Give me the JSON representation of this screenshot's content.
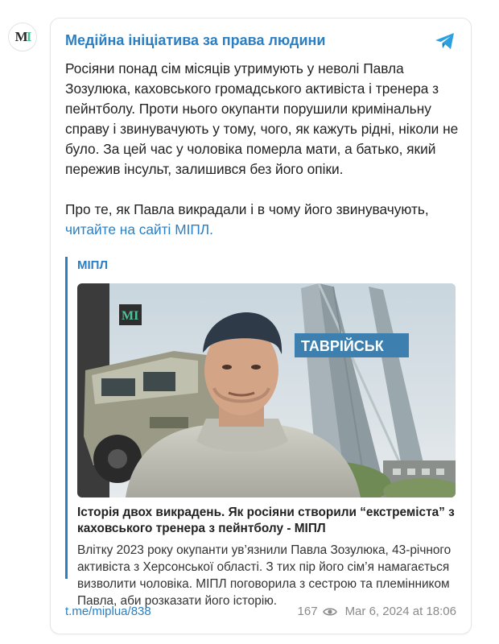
{
  "channel": {
    "name": "Медійна ініціатива за права людини",
    "avatar_mark": "МІ",
    "avatar_accent": "#4fc19a"
  },
  "post": {
    "paragraph1": "Росіяни понад сім місяців утримують у неволі Павла Зозулюка, каховського громадського активіста і тренера з пейнтболу. Проти нього окупанти порушили кримінальну справу і звинувачують у тому, чого, як кажуть рідні, ніколи не було. За цей час у чоловіка померла мати, а батько, який пережив інсульт, залишився без його опіки.",
    "paragraph2_text": "Про те, як Павла викрадали і в чому його звинувачують, ",
    "paragraph2_link": "читайте на сайті МІПЛ."
  },
  "preview": {
    "site": "МІПЛ",
    "image_sign_text": "ТАВРІЙСЬК",
    "image_logo": "МІ",
    "title": "Історія двох викрадень. Як росіяни створили “екстреміста” з каховського тренера з пейнтболу - МІПЛ",
    "description": "Влітку 2023 року окупанти ув’язнили Павла Зозулюка, 43-річного активіста з Херсонської області. З тих пір його сім’я намагається визволити чоловіка. МІПЛ поговорила з сестрою та племінником Павла, аби розказати його історію."
  },
  "footer": {
    "link": "t.me/miplua/838",
    "views": "167",
    "timestamp": "Mar 6, 2024 at 18:06"
  },
  "colors": {
    "link": "#2b7fc2",
    "muted": "#8a8a8a"
  }
}
